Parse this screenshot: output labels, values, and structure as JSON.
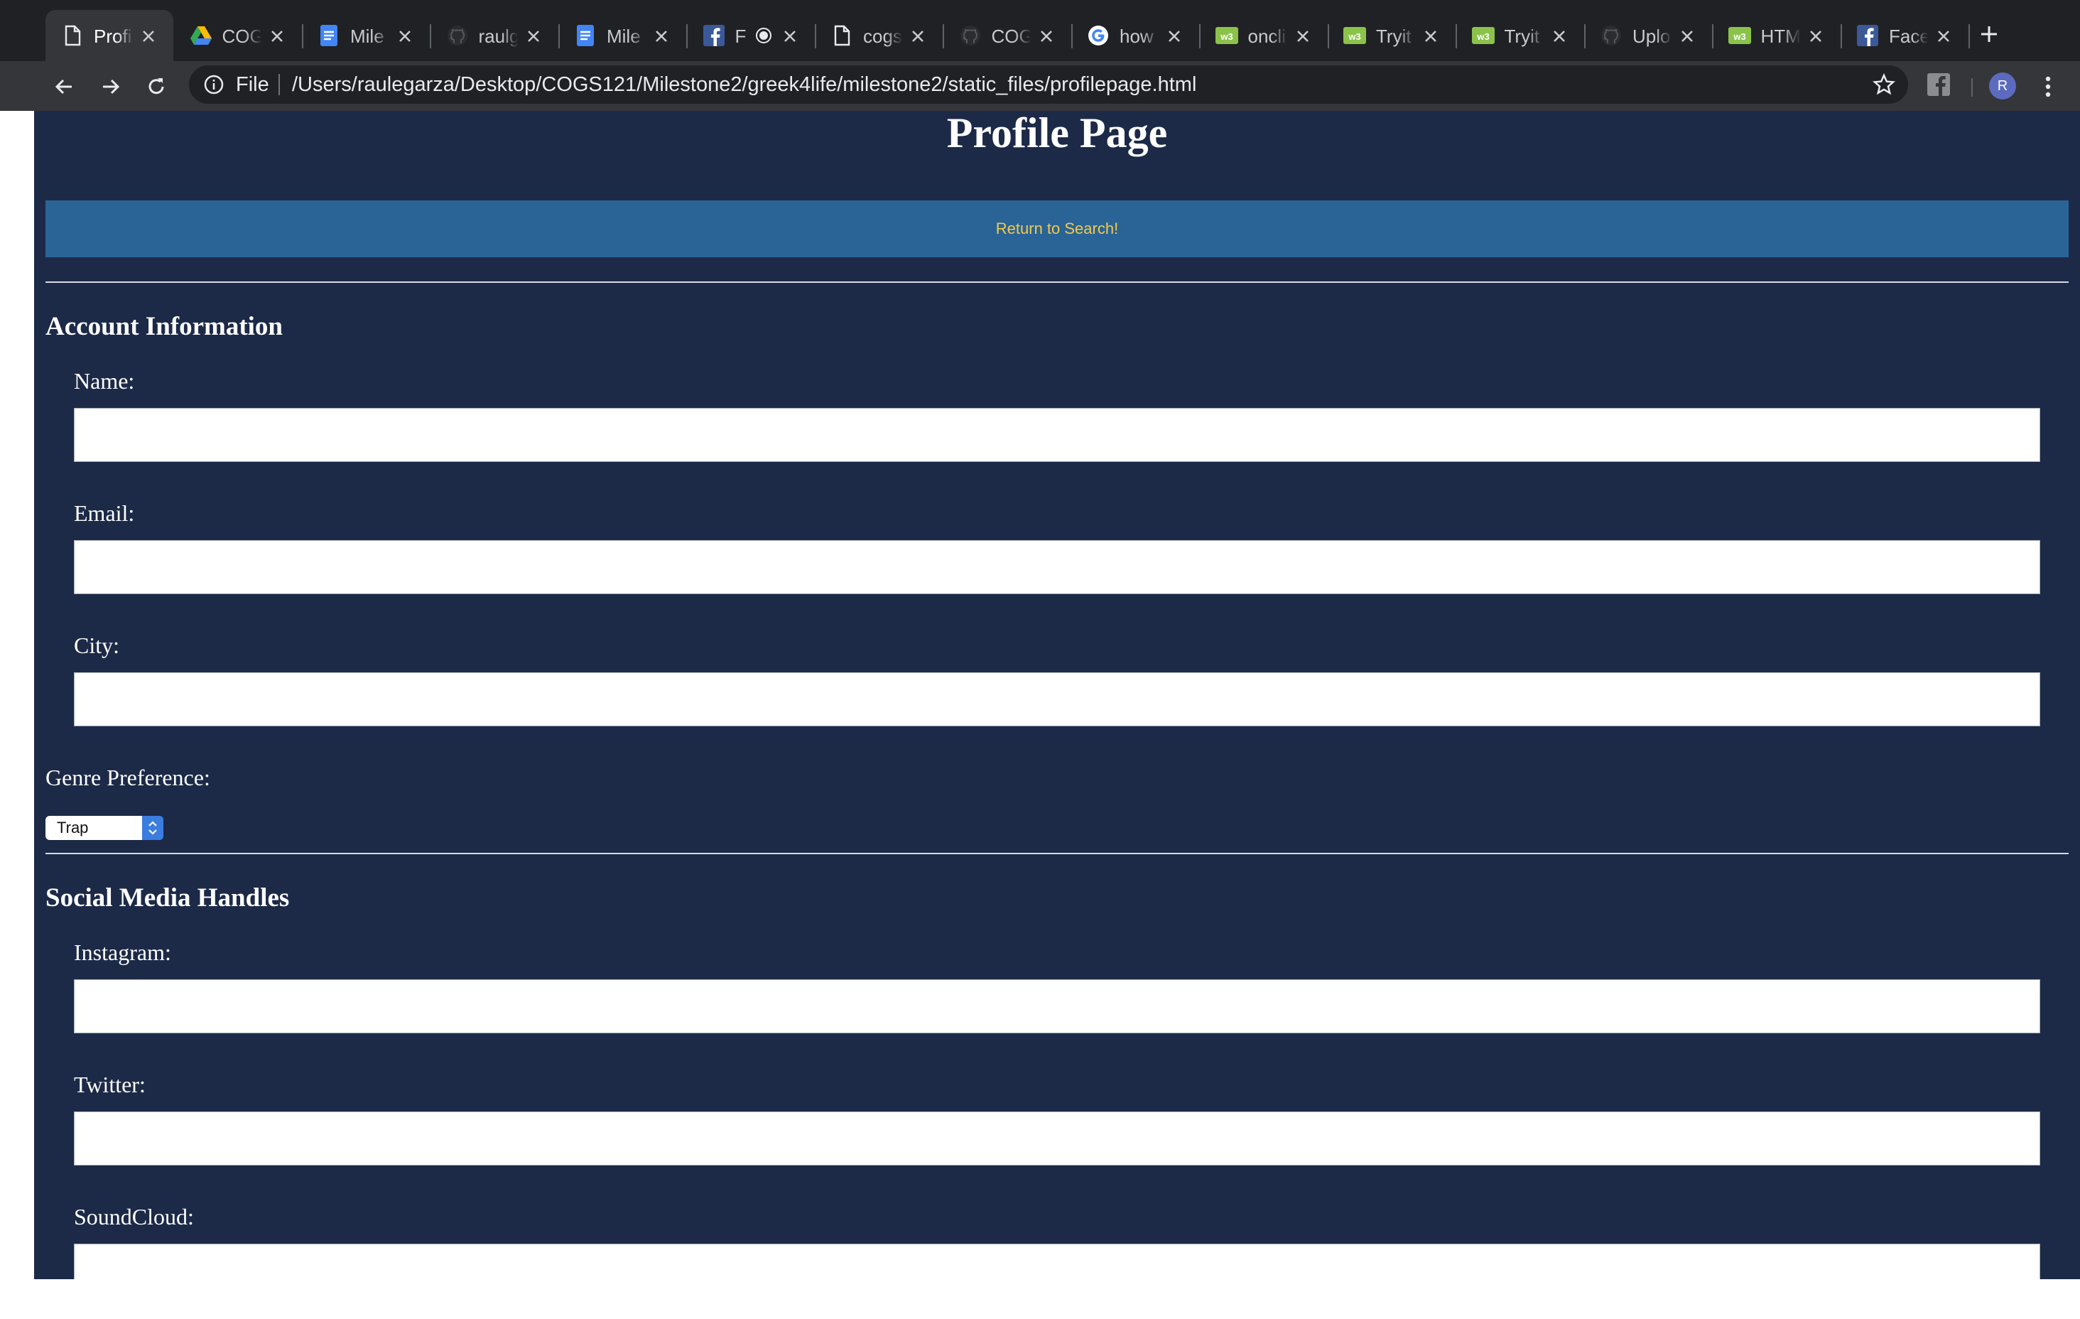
{
  "browser": {
    "tabs": [
      {
        "title": "Profi",
        "icon": "page-icon",
        "active": true
      },
      {
        "title": "COG",
        "icon": "drive-icon"
      },
      {
        "title": "Mile",
        "icon": "docs-icon"
      },
      {
        "title": "raulg",
        "icon": "github-icon"
      },
      {
        "title": "Mile",
        "icon": "docs-icon"
      },
      {
        "title": "F",
        "icon": "facebook-icon",
        "recording": true
      },
      {
        "title": "cogs",
        "icon": "page-icon"
      },
      {
        "title": "COG",
        "icon": "github-icon"
      },
      {
        "title": "how",
        "icon": "google-icon"
      },
      {
        "title": "oncli",
        "icon": "w3schools-icon"
      },
      {
        "title": "Tryit",
        "icon": "w3schools-icon"
      },
      {
        "title": "Tryit",
        "icon": "w3schools-icon"
      },
      {
        "title": "Uplo",
        "icon": "github-icon"
      },
      {
        "title": "HTM",
        "icon": "w3schools-icon"
      },
      {
        "title": "Face",
        "icon": "facebook-icon"
      }
    ],
    "address": {
      "scheme": "File",
      "url": "/Users/raulegarza/Desktop/COGS121/Milestone2/greek4life/milestone2/static_files/profilepage.html"
    },
    "profile_initial": "R"
  },
  "page": {
    "title": "Profile Page",
    "return_link": "Return to Search!",
    "account_section": {
      "heading": "Account Information",
      "name_label": "Name:",
      "email_label": "Email:",
      "city_label": "City:",
      "name_value": "",
      "email_value": "",
      "city_value": ""
    },
    "genre": {
      "label": "Genre Preference:",
      "selected": "Trap"
    },
    "social_section": {
      "heading": "Social Media Handles",
      "instagram_label": "Instagram:",
      "twitter_label": "Twitter:",
      "soundcloud_label": "SoundCloud:",
      "instagram_value": "",
      "twitter_value": "",
      "soundcloud_value": ""
    }
  },
  "colors": {
    "page_bg": "#1c2a48",
    "return_bar": "#2a6496",
    "return_link": "#f2c94c",
    "chrome_dark": "#202124",
    "chrome_toolbar": "#35363a"
  }
}
